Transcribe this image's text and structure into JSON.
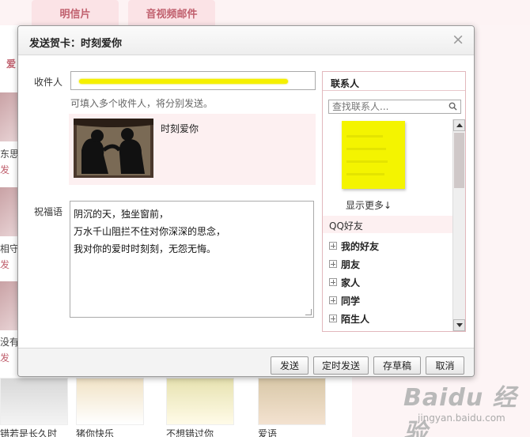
{
  "background": {
    "tabs": [
      "明信片",
      "音视频邮件"
    ],
    "love_label": "爱",
    "side_items": [
      {
        "label": "东思念",
        "link": "发"
      },
      {
        "label": "相守",
        "link": "发"
      },
      {
        "label": "没有",
        "link": "发"
      }
    ],
    "bottom_cards": [
      "错若是长久时",
      "猪你快乐",
      "不想错过你",
      "爱语"
    ],
    "watermark": {
      "main": "Baidu 经验",
      "sub": "jingyan.baidu.com"
    }
  },
  "dialog": {
    "title": "发送贺卡：时刻爱你",
    "close_symbol": "×",
    "recipient_label": "收件人",
    "recipient_hint": "可填入多个收件人，将分别发送。",
    "card_name": "时刻爱你",
    "message_label": "祝福语",
    "message_lines": [
      "阴沉的天，独坐窗前，",
      "万水千山阻拦不住对你深深的思念，",
      "我对你的爱时时刻刻，无怨无悔。"
    ]
  },
  "contacts": {
    "header": "联系人",
    "search_placeholder": "查找联系人...",
    "show_more": "显示更多↓",
    "qq_header": "QQ好友",
    "groups": [
      "我的好友",
      "朋友",
      "家人",
      "同学",
      "陌生人"
    ]
  },
  "footer": {
    "send": "发送",
    "scheduled_send": "定时发送",
    "save_draft": "存草稿",
    "cancel": "取消"
  },
  "colors": {
    "accent": "#c0606e",
    "highlight": "#f5f000",
    "panel_border": "#e2b8bd"
  }
}
